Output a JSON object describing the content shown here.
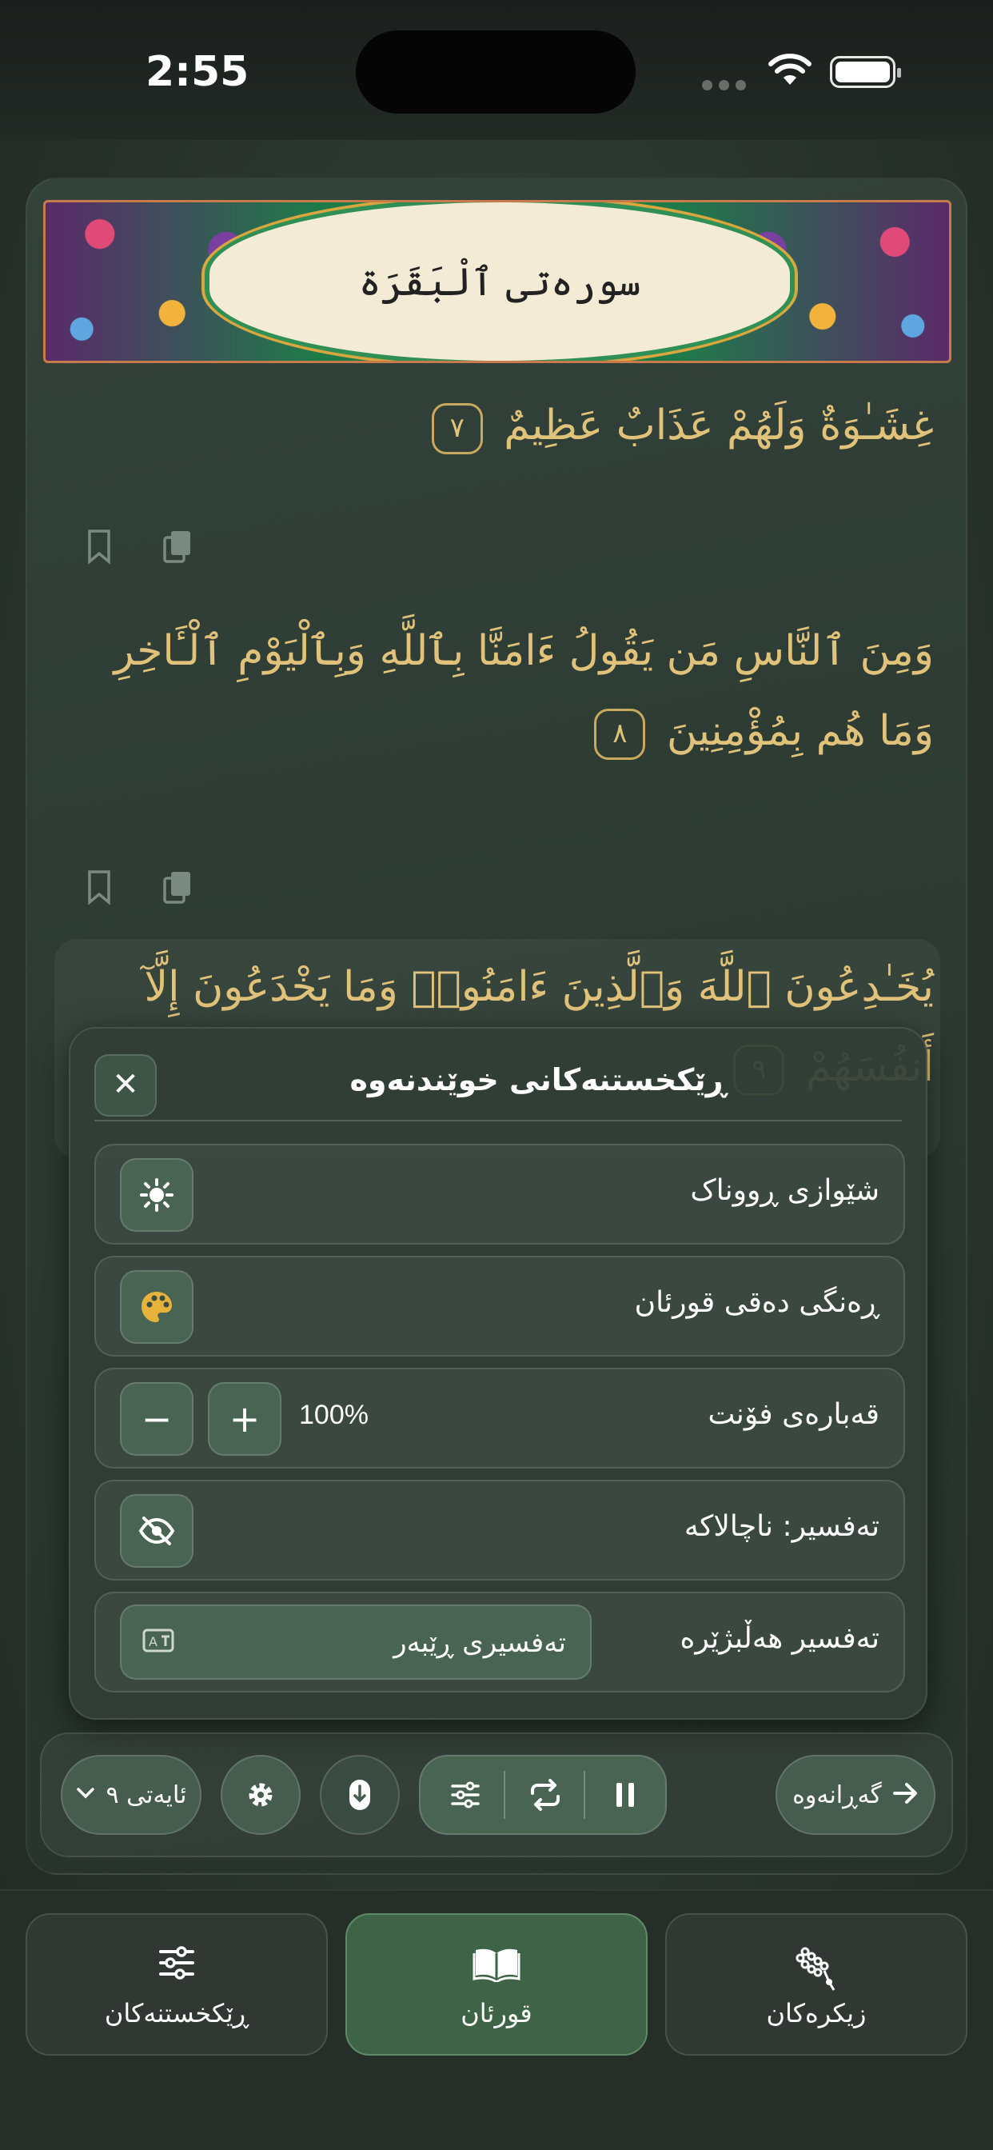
{
  "status_bar": {
    "time": "2:55"
  },
  "surah": {
    "title": "سورەتی ٱلْبَقَرَة"
  },
  "ayahs": [
    {
      "text": "غِشَـٰوَةٌ وَلَهُمْ عَذَابٌ عَظِيمٌ",
      "number": "٧"
    },
    {
      "text": "وَمِنَ ٱلنَّاسِ مَن يَقُولُ ءَامَنَّا بِٱللَّهِ وَبِٱلْيَوْمِ ٱلْـَٔاخِرِ وَمَا هُم بِمُؤْمِنِينَ",
      "number": "٨"
    },
    {
      "text": "يُخَـٰدِعُونَ ٱللَّهَ وَٱلَّذِينَ ءَامَنُوا۟ وَمَا يَخْدَعُونَ إِلَّآ أَنفُسَهُمْ",
      "number": "٩"
    }
  ],
  "settings_panel": {
    "title": "ڕێکخستنەکانی خوێندنەوە",
    "light_mode_label": "شێوازی ڕووناک",
    "quran_color_label": "ڕەنگی دەقی قورئان",
    "font_size_label": "قەبارەی فۆنت",
    "font_size_value": "100%",
    "tafsir_status_label": "تەفسیر: ناچالاکە",
    "tafsir_select_label": "تەفسیر هەڵبژێرە",
    "tafsir_selected": "تەفسیری ڕێبەر"
  },
  "player": {
    "back_label": "گەڕانەوە",
    "ayah_selector": "ئایەتی ٩"
  },
  "tabs": [
    {
      "label": "زیکرەکان",
      "icon": "tasbih-icon"
    },
    {
      "label": "قورئان",
      "icon": "open-book-icon"
    },
    {
      "label": "ڕێکخستنەکان",
      "icon": "sliders-icon"
    }
  ],
  "colors": {
    "accent": "#3f6347",
    "quran_text": "#e0c27a",
    "background": "#2b362f"
  }
}
